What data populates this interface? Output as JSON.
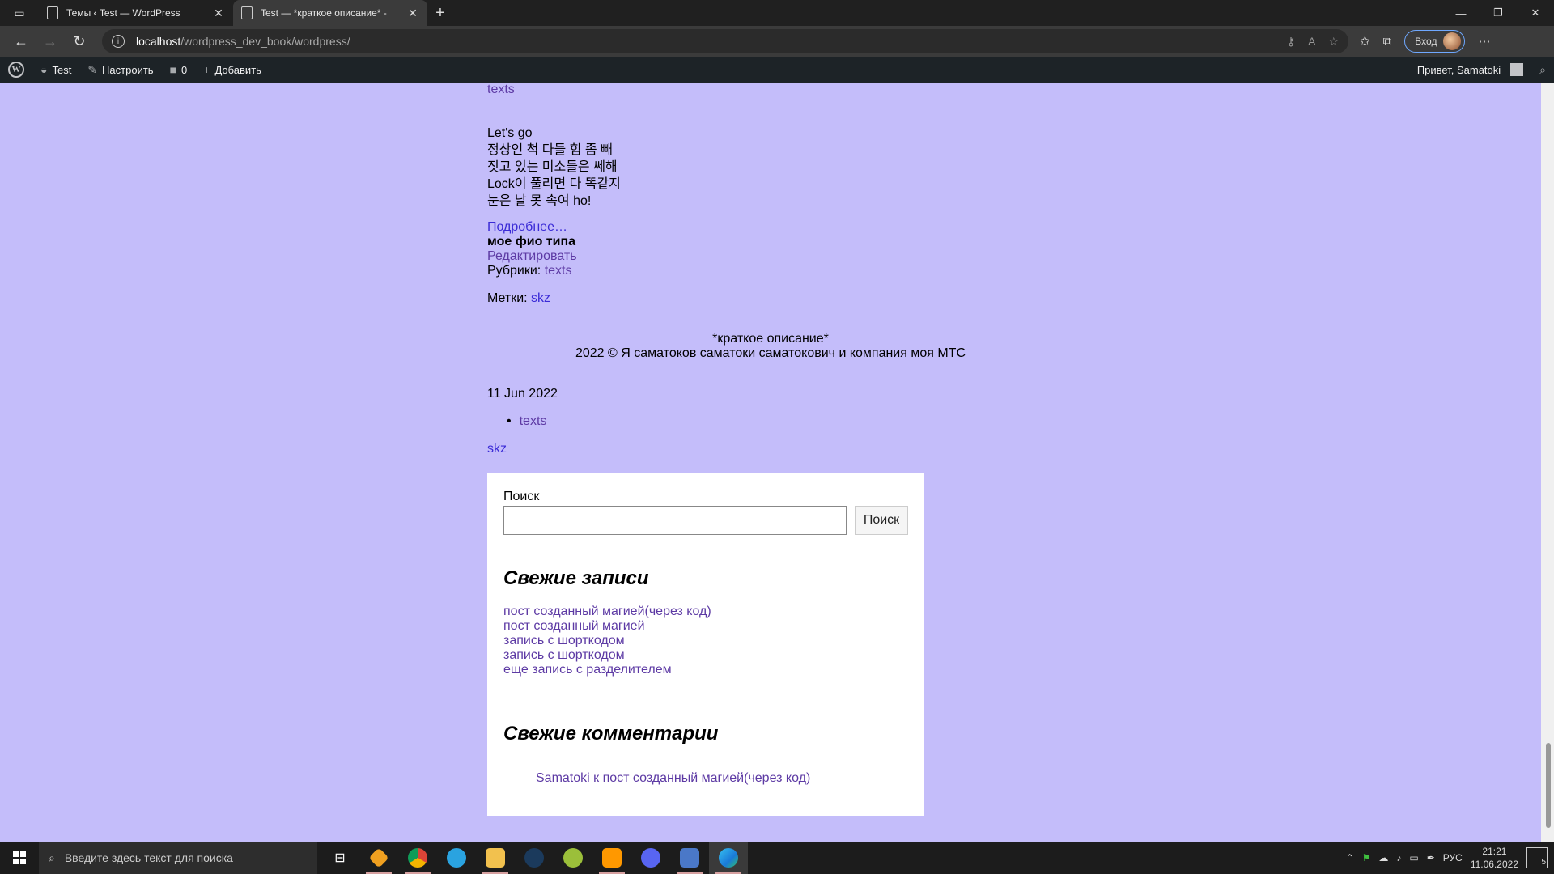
{
  "browser": {
    "tabs": [
      {
        "label": "Темы ‹ Test — WordPress",
        "active": false
      },
      {
        "label": "Test — *краткое описание* -",
        "active": true
      }
    ],
    "new_tab": "+",
    "url_host": "localhost",
    "url_path": "/wordpress_dev_book/wordpress/",
    "login_label": "Вход"
  },
  "adminbar": {
    "site_name": "Test",
    "customize": "Настроить",
    "comments_count": "0",
    "add_new": "Добавить",
    "greeting": "Привет, Samatoki"
  },
  "post": {
    "category_top": "texts",
    "lyrics": [
      "Let's go",
      "정상인 척 다들 힘 좀 빼",
      "짓고 있는 미소들은 쎄해",
      "Lock이 풀리면 다 똑같지",
      "눈은 날 못 속여 ho!"
    ],
    "more_link": "Подробнее…",
    "author": "мое фио типа",
    "edit_link": "Редактировать",
    "categories_label": "Рубрики: ",
    "categories_value": "texts",
    "tags_label": "Метки: ",
    "tags_value": "skz"
  },
  "footer": {
    "description": "*краткое описание*",
    "copyright": "2022 © Я саматоков саматоки саматокович и компания моя МТС"
  },
  "meta": {
    "date": "11 Jun 2022",
    "category_item": "texts",
    "tag": "skz"
  },
  "sidebar": {
    "search_label": "Поиск",
    "search_value": "",
    "search_button": "Поиск",
    "recent_posts_title": "Свежие записи",
    "recent_posts": [
      "пост созданный магией(через код)",
      "пост созданный магией",
      "запись с шорткодом",
      "запись с шорткодом",
      "еще запись с разделителем"
    ],
    "recent_comments_title": "Свежие комментарии",
    "comment_author": "Samatoki",
    "comment_sep": " к ",
    "comment_post": "пост созданный магией(через код)"
  },
  "taskbar": {
    "search_placeholder": "Введите здесь текст для поиска",
    "lang": "РУС",
    "time": "21:21",
    "date": "11.06.2022",
    "notifications": "5"
  },
  "colors": {
    "page_bg": "#c4bdfa",
    "link": "#3a2ad6",
    "visited": "#5d3aa4",
    "adminbar": "#1d2327"
  }
}
